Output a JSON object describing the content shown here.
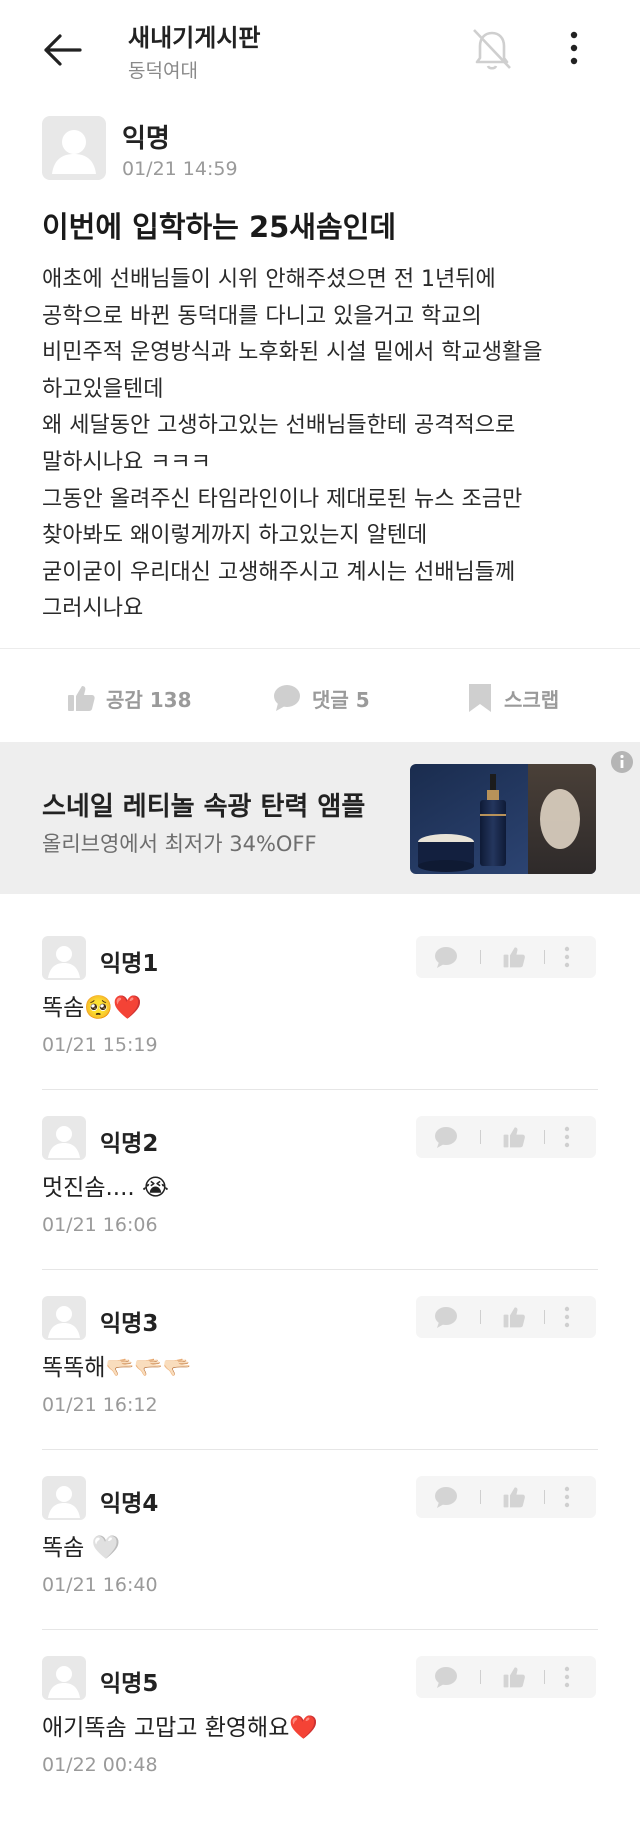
{
  "header": {
    "title": "새내기게시판",
    "subtitle": "동덕여대"
  },
  "post": {
    "author": "익명",
    "time": "01/21 14:59",
    "title": "이번에 입학하는 25새솜인데",
    "body_lines": [
      "애초에 선배님들이 시위 안해주셨으면 전 1년뒤에",
      "공학으로 바뀐 동덕대를 다니고 있을거고 학교의",
      "비민주적 운영방식과 노후화된 시설 밑에서 학교생활을",
      "하고있을텐데",
      "왜 세달동안 고생하고있는 선배님들한테 공격적으로",
      "말하시나요 ㅋㅋㅋ",
      "그동안 올려주신 타임라인이나 제대로된 뉴스 조금만",
      "찾아봐도 왜이렇게까지 하고있는지 알텐데",
      "굳이굳이 우리대신 고생해주시고 계시는 선배님들께",
      "그러시나요"
    ]
  },
  "actions": {
    "like": "공감 138",
    "comment": "댓글 5",
    "scrap": "스크랩"
  },
  "ad": {
    "title": "스네일 레티놀 속광 탄력 앰플",
    "subtitle": "올리브영에서 최저가 34%OFF"
  },
  "comments": [
    {
      "name": "익명1",
      "text": "똑솜🥺❤️",
      "time": "01/21 15:19"
    },
    {
      "name": "익명2",
      "text": "멋진솜.... 😭",
      "time": "01/21 16:06"
    },
    {
      "name": "익명3",
      "text": "똑똑해🫳🏻🫳🏻🫳🏻",
      "time": "01/21 16:12"
    },
    {
      "name": "익명4",
      "text": "똑솜 🤍",
      "time": "01/21 16:40"
    },
    {
      "name": "익명5",
      "text": "애기똑솜 고맙고 환영해요❤️",
      "time": "01/22 00:48"
    }
  ],
  "colors": {
    "heart": "#ff3b5c",
    "muted": "#9a9a9a",
    "ad_bg": "#eeeeee"
  }
}
